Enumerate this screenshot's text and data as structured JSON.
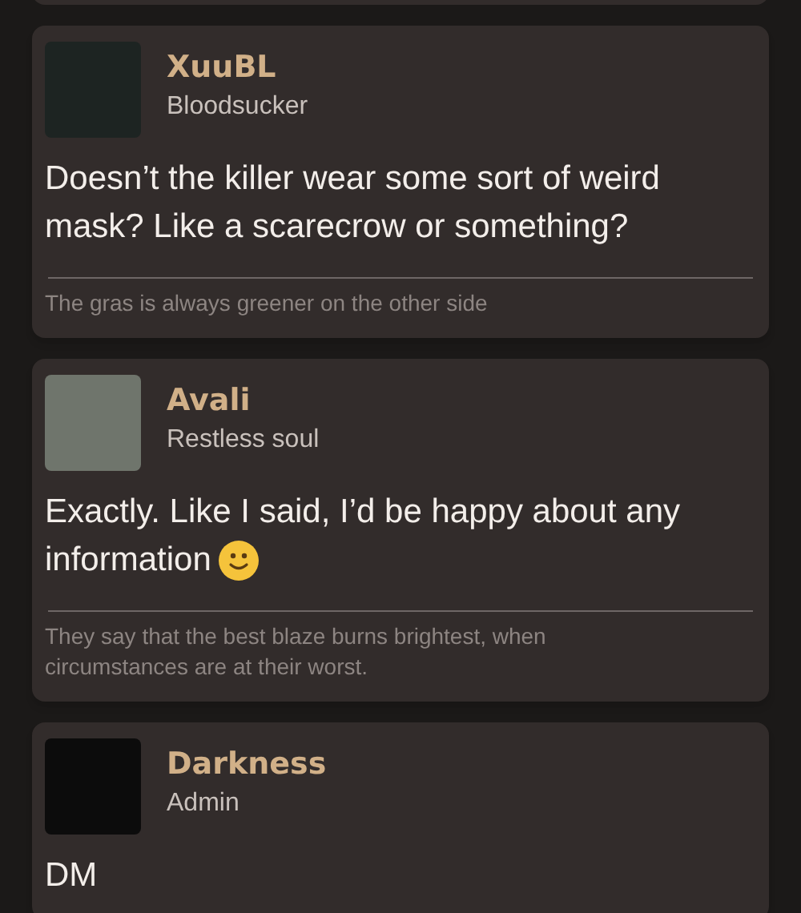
{
  "posts": [
    {
      "author": "XuuBL",
      "rank": "Bloodsucker",
      "body": "Doesn’t the killer wear some sort of weird mask? Like a scarecrow or something?",
      "smiley": false,
      "signature": "The gras is always greener on the other side"
    },
    {
      "author": "Avali",
      "rank": "Restless soul",
      "body": "Exactly. Like I said, I’d be happy about any information",
      "smiley": true,
      "signature": "They say that the best blaze burns brightest, when circumstances are at their worst."
    },
    {
      "author": "Darkness",
      "rank": "Admin",
      "body": "DM",
      "smiley": false
    }
  ]
}
